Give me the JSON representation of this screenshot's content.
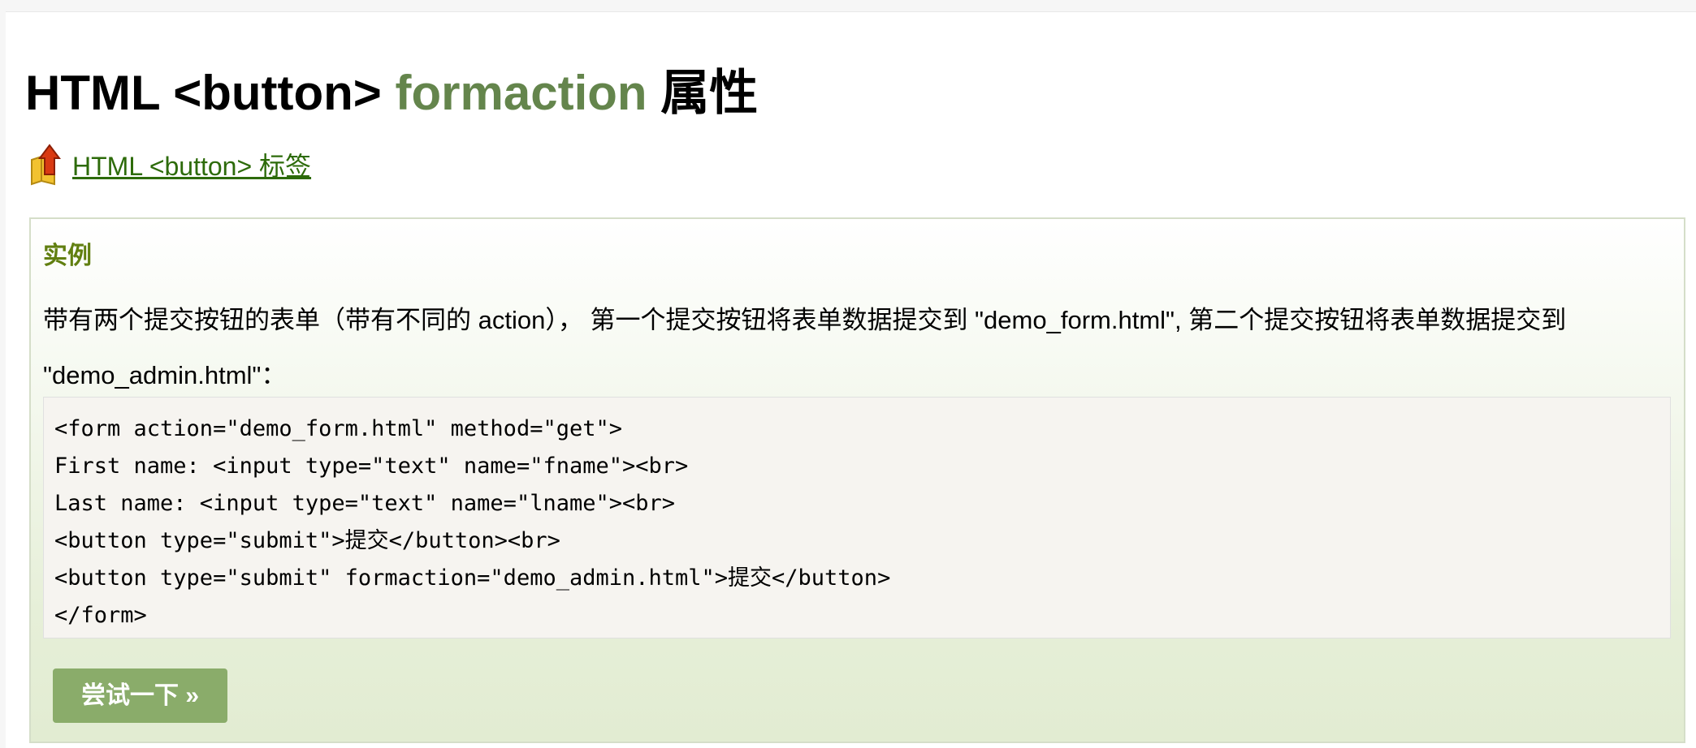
{
  "page": {
    "title_prefix": "HTML <button> ",
    "title_accent": "formaction",
    "title_suffix": " 属性",
    "back_link": {
      "label": " HTML <button> 标签",
      "icon": "up-arrow-folder-icon"
    }
  },
  "example": {
    "heading": "实例",
    "description": "带有两个提交按钮的表单（带有不同的 action），  第一个提交按钮将表单数据提交到 \"demo_form.html\", 第二个提交按钮将表单数据提交到 \"demo_admin.html\"：",
    "code_lines": [
      "<form action=\"demo_form.html\" method=\"get\">",
      "First name: <input type=\"text\" name=\"fname\"><br>",
      "Last name: <input type=\"text\" name=\"lname\"><br>",
      "<button type=\"submit\">提交</button><br>",
      "<button type=\"submit\" formaction=\"demo_admin.html\">提交</button>",
      "</form>"
    ],
    "try_button_label": "尝试一下 »"
  },
  "colors": {
    "accent_green": "#64854c",
    "link_green": "#2d6b0a",
    "heading_green": "#617f10",
    "button_green": "#8aac6a"
  }
}
